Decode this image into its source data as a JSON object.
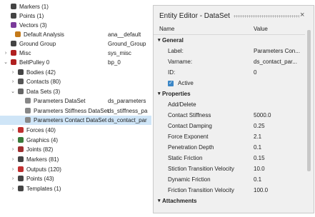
{
  "tree": {
    "rows": [
      {
        "expander": "",
        "icon_color": "#444",
        "label": "Markers (1)",
        "value": ""
      },
      {
        "expander": "",
        "icon_color": "#444",
        "label": "Points (1)",
        "value": ""
      },
      {
        "expander": "",
        "icon_color": "#7a3a9a",
        "label": "Vectors (3)",
        "value": ""
      },
      {
        "expander": "",
        "icon_color": "#c47a1a",
        "label": "Default Analysis",
        "value": "ana__default"
      },
      {
        "expander": "",
        "icon_color": "#444",
        "label": "Ground Group",
        "value": "Ground_Group"
      },
      {
        "expander": "›",
        "icon_color": "#b02020",
        "label": "Misc",
        "value": "sys_misc"
      },
      {
        "expander": "⌄",
        "icon_color": "#b02020",
        "label": "BeltPulley 0",
        "value": "bp_0"
      },
      {
        "expander": "›",
        "icon_color": "#444",
        "label": "Bodies (42)",
        "value": ""
      },
      {
        "expander": "›",
        "icon_color": "#555",
        "label": "Contacts (80)",
        "value": ""
      },
      {
        "expander": "⌄",
        "icon_color": "#666",
        "label": "Data Sets (3)",
        "value": ""
      },
      {
        "expander": "",
        "icon_color": "#888",
        "label": "Parameters DataSet",
        "value": "ds_parameters"
      },
      {
        "expander": "",
        "icon_color": "#888",
        "label": "Parameters Stiffness DataSet",
        "value": "ds_stiffness_pa"
      },
      {
        "expander": "",
        "icon_color": "#888",
        "label": "Parameters Contact DataSet",
        "value": "ds_contact_par"
      },
      {
        "expander": "›",
        "icon_color": "#c03030",
        "label": "Forces (40)",
        "value": ""
      },
      {
        "expander": "›",
        "icon_color": "#3a7a3a",
        "label": "Graphics (4)",
        "value": ""
      },
      {
        "expander": "›",
        "icon_color": "#a03030",
        "label": "Joints (82)",
        "value": ""
      },
      {
        "expander": "›",
        "icon_color": "#444",
        "label": "Markers (81)",
        "value": ""
      },
      {
        "expander": "›",
        "icon_color": "#c03030",
        "label": "Outputs (120)",
        "value": ""
      },
      {
        "expander": "›",
        "icon_color": "#444",
        "label": "Points (43)",
        "value": ""
      },
      {
        "expander": "›",
        "icon_color": "#444",
        "label": "Templates (1)",
        "value": ""
      }
    ]
  },
  "editor": {
    "title": "Entity Editor - DataSet",
    "close": "×",
    "col_name": "Name",
    "col_value": "Value",
    "rows": [
      {
        "kind": "section",
        "label": "General",
        "value": ""
      },
      {
        "kind": "prop",
        "label": "Label:",
        "value": "Parameters Con..."
      },
      {
        "kind": "prop",
        "label": "Varname:",
        "value": "ds_contact_par..."
      },
      {
        "kind": "prop",
        "label": "ID:",
        "value": "0"
      },
      {
        "kind": "check",
        "label": "Active",
        "value": ""
      },
      {
        "kind": "section",
        "label": "Properties",
        "value": ""
      },
      {
        "kind": "action",
        "label": "Add/Delete",
        "value": ""
      },
      {
        "kind": "prop",
        "label": "Contact Stiffness",
        "value": "5000.0"
      },
      {
        "kind": "prop",
        "label": "Contact Damping",
        "value": "0.25"
      },
      {
        "kind": "prop",
        "label": "Force Exponent",
        "value": "2.1"
      },
      {
        "kind": "prop",
        "label": "Penetration Depth",
        "value": "0.1"
      },
      {
        "kind": "prop",
        "label": "Static Friction",
        "value": "0.15"
      },
      {
        "kind": "prop",
        "label": "Stiction Transition Velocity",
        "value": "10.0"
      },
      {
        "kind": "prop",
        "label": "Dynamic Friction",
        "value": "0.1"
      },
      {
        "kind": "prop",
        "label": "Friction Transition Velocity",
        "value": "100.0"
      },
      {
        "kind": "section",
        "label": "Attachments",
        "value": ""
      }
    ]
  }
}
